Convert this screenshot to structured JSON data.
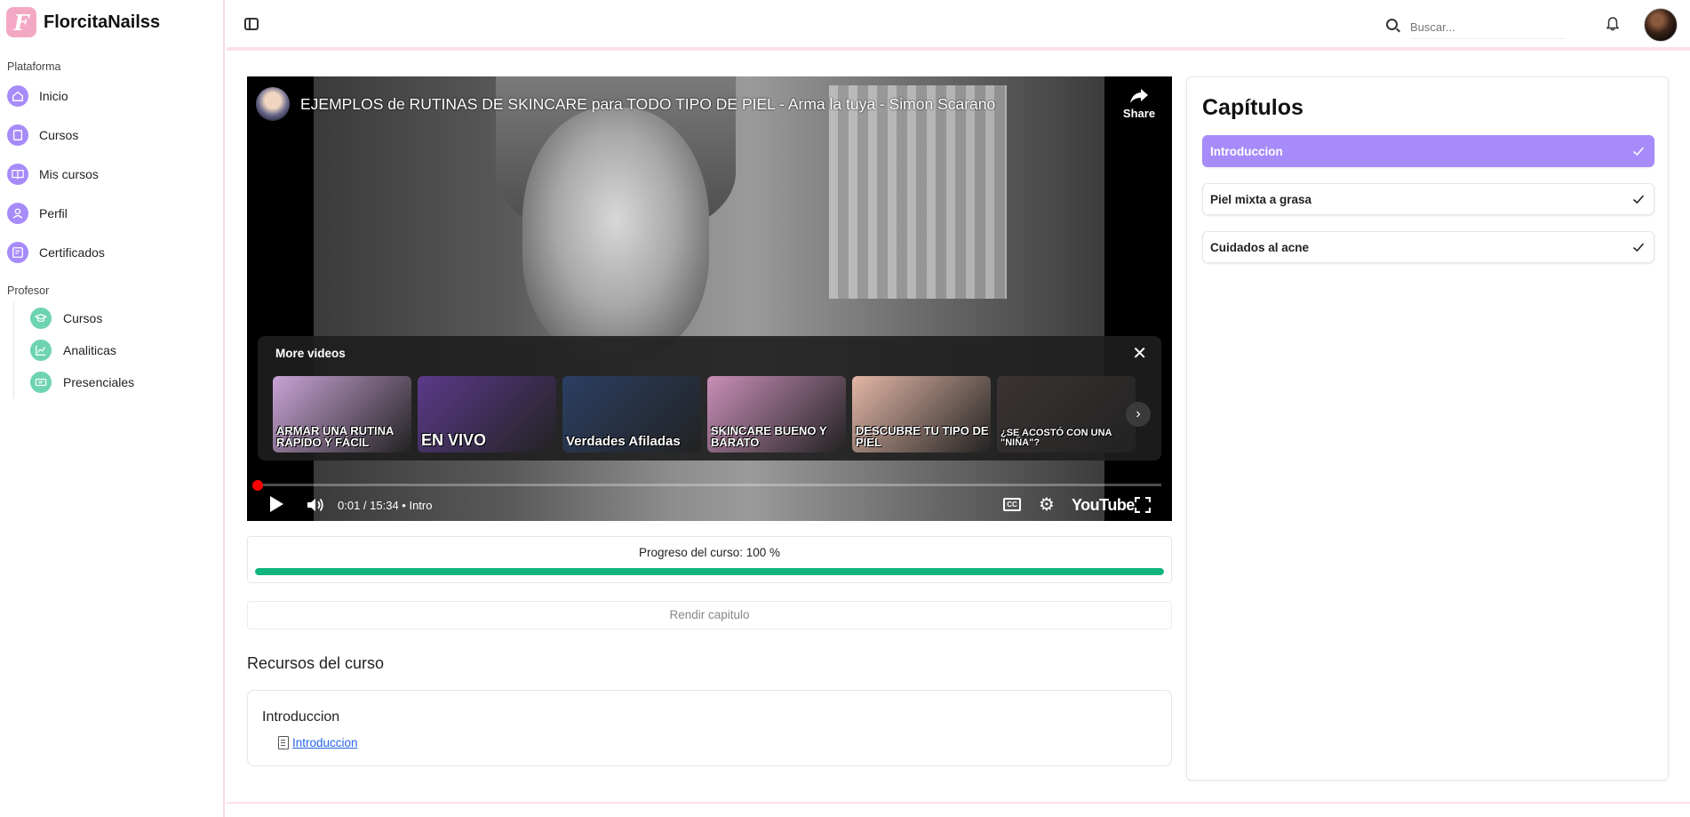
{
  "brand": {
    "name": "FlorcitaNailss",
    "logo_letter": "F"
  },
  "sidebar": {
    "platform_label": "Plataforma",
    "platform_items": [
      {
        "label": "Inicio",
        "icon": "home-icon"
      },
      {
        "label": "Cursos",
        "icon": "book-icon"
      },
      {
        "label": "Mis cursos",
        "icon": "book-open-icon"
      },
      {
        "label": "Perfil",
        "icon": "user-icon"
      },
      {
        "label": "Certificados",
        "icon": "certificate-icon"
      }
    ],
    "teacher_label": "Profesor",
    "teacher_items": [
      {
        "label": "Cursos",
        "icon": "graduation-cap-icon"
      },
      {
        "label": "Analiticas",
        "icon": "chart-icon"
      },
      {
        "label": "Presenciales",
        "icon": "ticket-icon"
      }
    ]
  },
  "topbar": {
    "search_placeholder": "Buscar..."
  },
  "video": {
    "title": "EJEMPLOS de RUTINAS DE SKINCARE para TODO TIPO DE PIEL - Arma la tuya - Simon Scarano",
    "share_label": "Share",
    "more_videos_label": "More videos",
    "thumbnails": [
      {
        "text": "ARMAR UNA RUTINA RÁPIDO Y FÁCIL",
        "bg": "#c9a3d6"
      },
      {
        "text": "EN VIVO",
        "bg": "#5b3a8a"
      },
      {
        "text": "Verdades Afiladas",
        "bg": "#2b3f63"
      },
      {
        "text": "SKINCARE BUENO Y BARATO",
        "bg": "#c98fb8"
      },
      {
        "text": "DESCUBRE TU TIPO DE PIEL",
        "bg": "#e3b7a6"
      },
      {
        "text": "¿SE ACOSTÓ CON UNA \"NIÑA\"?",
        "bg": "#3a3432"
      }
    ],
    "time": "0:01 / 15:34",
    "chapter": "Intro",
    "cc_label": "CC",
    "youtube_label": "YouTube",
    "progress_fraction": 0.001
  },
  "course_progress": {
    "label": "Progreso del curso: 100 %",
    "percent": 100
  },
  "render_button": "Rendir capitulo",
  "resources": {
    "title": "Recursos del curso",
    "card_title": "Introduccion",
    "link": "Introduccion"
  },
  "chapters": {
    "title": "Capítulos",
    "items": [
      {
        "label": "Introduccion",
        "active": true,
        "completed": true
      },
      {
        "label": "Piel mixta a grasa",
        "active": false,
        "completed": true
      },
      {
        "label": "Cuidados al acne",
        "active": false,
        "completed": true
      }
    ]
  },
  "colors": {
    "accent": "#a78bfa",
    "teacher_accent": "#6dd3b0",
    "progress": "#10b47e",
    "brand": "#f3a8c4"
  }
}
